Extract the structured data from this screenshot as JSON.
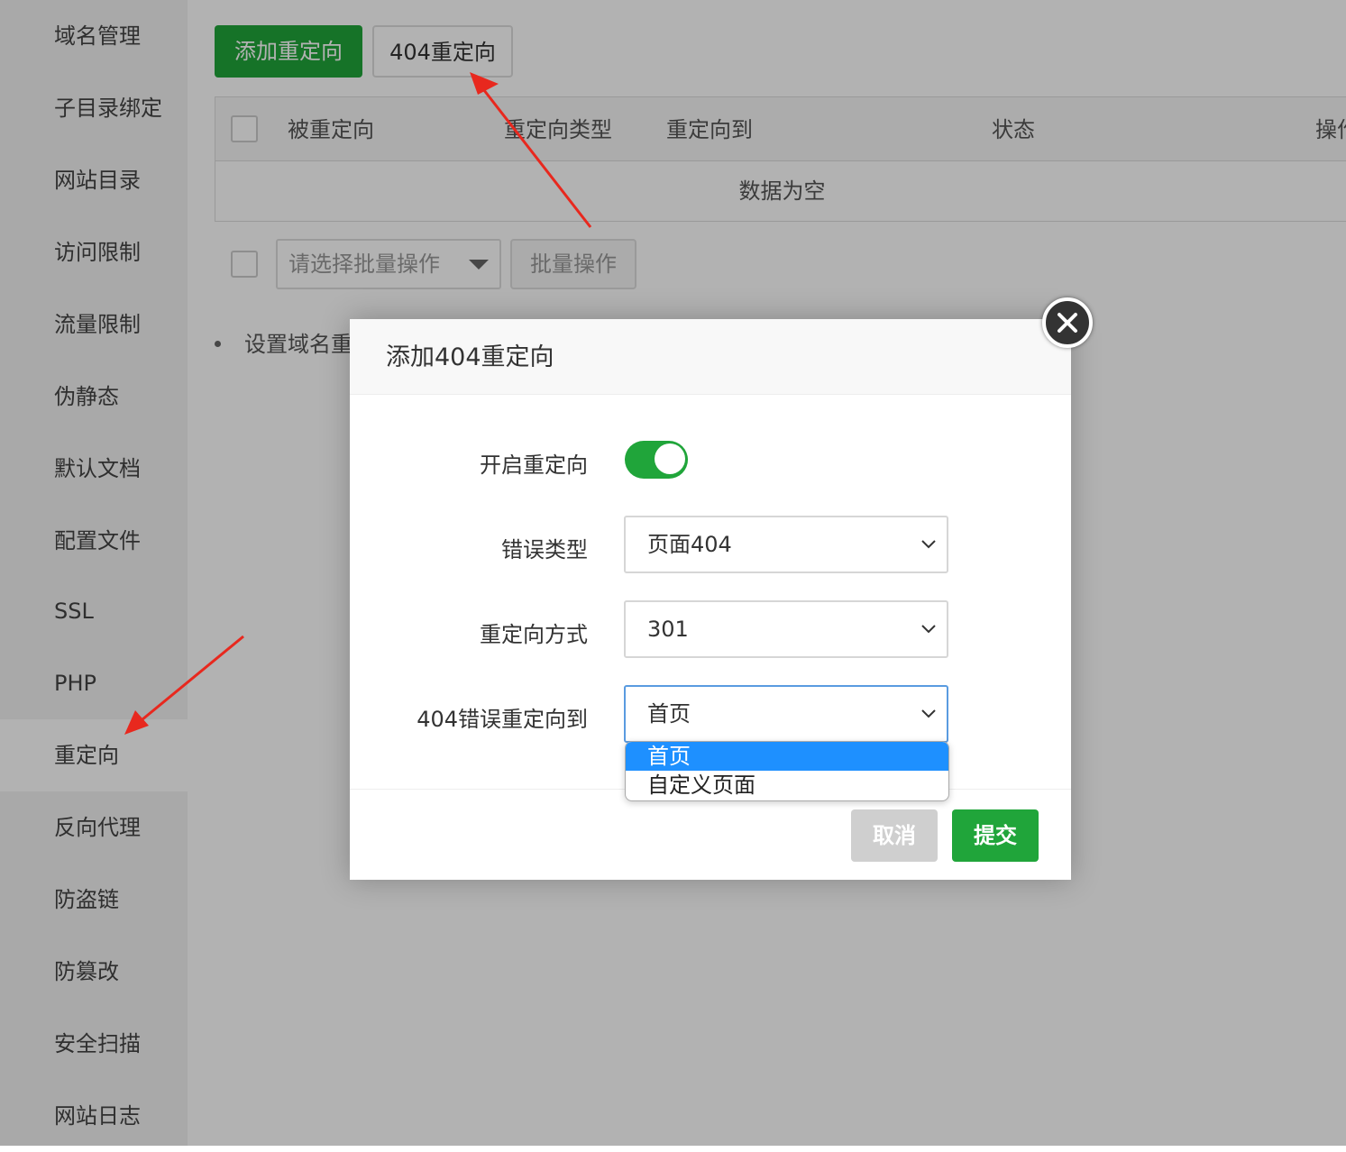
{
  "sidebar": {
    "items": [
      {
        "label": "域名管理"
      },
      {
        "label": "子目录绑定"
      },
      {
        "label": "网站目录"
      },
      {
        "label": "访问限制"
      },
      {
        "label": "流量限制"
      },
      {
        "label": "伪静态"
      },
      {
        "label": "默认文档"
      },
      {
        "label": "配置文件"
      },
      {
        "label": "SSL"
      },
      {
        "label": "PHP"
      },
      {
        "label": "重定向",
        "active": true
      },
      {
        "label": "反向代理"
      },
      {
        "label": "防盗链"
      },
      {
        "label": "防篡改"
      },
      {
        "label": "安全扫描"
      },
      {
        "label": "网站日志"
      }
    ]
  },
  "toolbar": {
    "add_redirect": "添加重定向",
    "redirect_404": "404重定向"
  },
  "table": {
    "columns": [
      "被重定向",
      "重定向类型",
      "重定向到",
      "状态",
      "操作"
    ],
    "empty_text": "数据为空"
  },
  "batch": {
    "placeholder": "请选择批量操作",
    "button": "批量操作"
  },
  "tip": "设置域名重",
  "dialog": {
    "title": "添加404重定向",
    "enable_label": "开启重定向",
    "enable_on": true,
    "error_type_label": "错误类型",
    "error_type_value": "页面404",
    "method_label": "重定向方式",
    "method_value": "301",
    "target_label": "404错误重定向到",
    "target_value": "首页",
    "target_options": [
      "首页",
      "自定义页面"
    ],
    "cancel": "取消",
    "submit": "提交"
  },
  "colors": {
    "primary_green": "#20a53a",
    "option_highlight": "#1e90ff",
    "annotation_arrow": "#e8281e"
  }
}
